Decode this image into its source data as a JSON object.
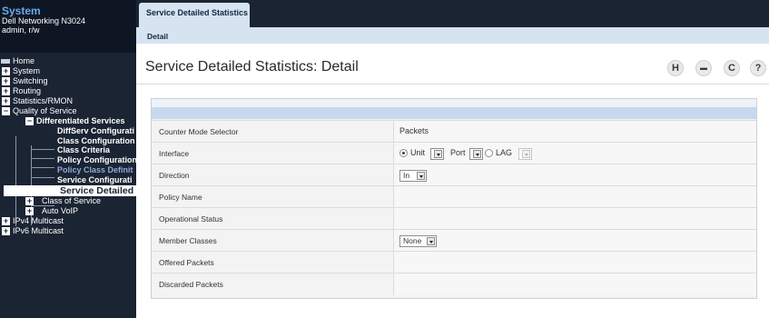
{
  "system": {
    "title": "System",
    "model": "Dell Networking N3024",
    "user": "admin, r/w"
  },
  "nav": {
    "home": "Home",
    "system": "System",
    "switching": "Switching",
    "routing": "Routing",
    "statistics_rmon": "Statistics/RMON",
    "qos": "Quality of Service",
    "diffserv": "Differentiated Services",
    "diffserv_config": "DiffServ Configurati",
    "class_config": "Class Configuration",
    "class_criteria": "Class Criteria",
    "policy_config": "Policy Configuration",
    "policy_class_def": "Policy Class Definit",
    "service_config": "Service Configurati",
    "service_detailed": "Service Detailed",
    "class_of_service": "Class of Service",
    "auto_voip": "Auto VoIP",
    "ipv4_multicast": "IPv4 Multicast",
    "ipv6_multicast": "IPv6 Multicast"
  },
  "tabs": {
    "main": "Service Detailed Statistics",
    "sub": "Detail"
  },
  "page": {
    "title": "Service Detailed Statistics: Detail"
  },
  "toolbar": {
    "help": "H",
    "print": "▬",
    "refresh": "C",
    "question": "?"
  },
  "form": {
    "counter_mode_label": "Counter Mode Selector",
    "counter_mode_value": "Packets",
    "interface_label": "Interface",
    "unit_label": "Unit",
    "port_label": "Port",
    "lag_label": "LAG",
    "direction_label": "Direction",
    "direction_value": "In",
    "policy_name_label": "Policy Name",
    "operational_status_label": "Operational Status",
    "member_classes_label": "Member Classes",
    "member_classes_value": "None",
    "offered_packets_label": "Offered Packets",
    "discarded_packets_label": "Discarded Packets"
  }
}
